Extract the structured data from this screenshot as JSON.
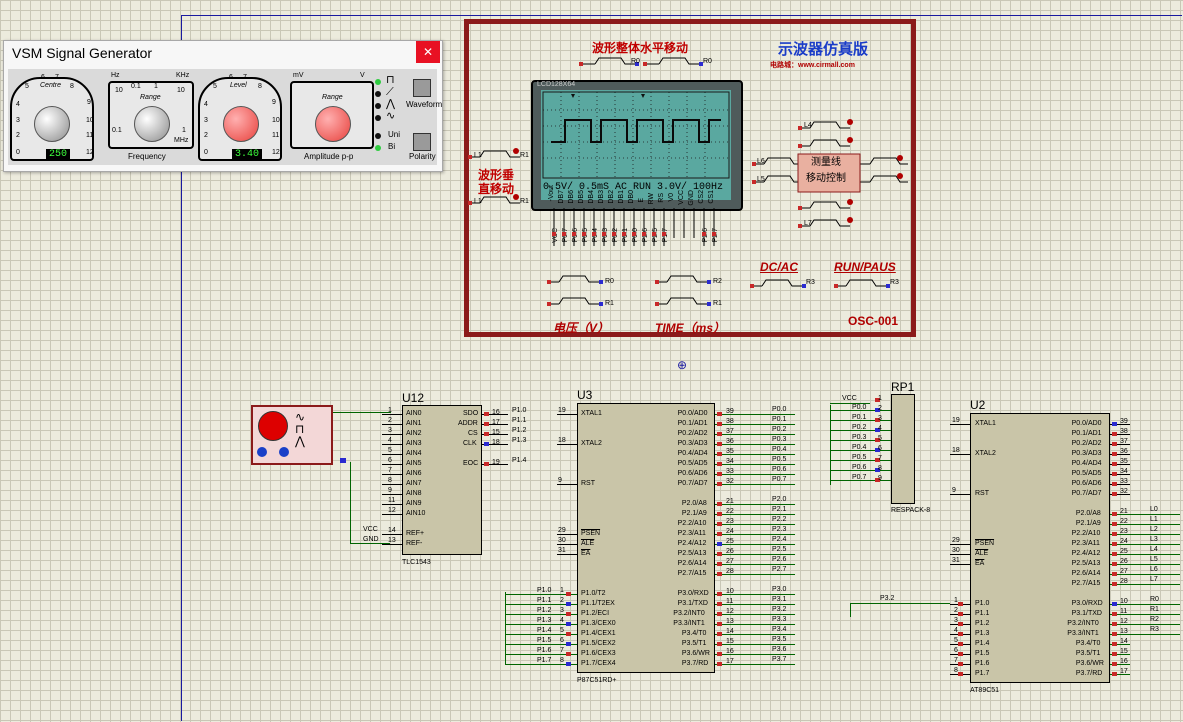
{
  "siggen": {
    "title": "VSM Signal Generator",
    "close_icon": "close-icon",
    "centre_label": "Centre",
    "range_label": "Range",
    "level_label": "Level",
    "amp_range_label": "Range",
    "frequency_label": "Frequency",
    "amplitude_label": "Amplitude p-p",
    "waveform_label": "Waveform",
    "polarity_label": "Polarity",
    "uni_label": "Uni",
    "bi_label": "Bi",
    "centre_value": "250",
    "level_value": "3.40",
    "hz_label": "Hz",
    "khz_label": "KHz",
    "mhz_label": "MHz",
    "mv_label": "mV",
    "v_label": "V",
    "scale_a": [
      "5",
      "6",
      "7",
      "8",
      "9",
      "10",
      "11",
      "12",
      "4",
      "3",
      "2",
      "1",
      "0"
    ],
    "range_a": [
      "10",
      "0.1",
      "1",
      "10",
      "0.1",
      "1"
    ],
    "scale_c": [
      "5",
      "6",
      "7",
      "8",
      "9",
      "10",
      "11",
      "12",
      "4",
      "3",
      "2",
      "1",
      "0"
    ],
    "range_c": [
      "mV",
      "V"
    ]
  },
  "osc": {
    "title": "示波器仿真版",
    "vendor": "电路城：www.cirmall.com",
    "h_move": "波形整体水平移动",
    "v_move": "波形垂直移动",
    "v_move_1": "波形垂",
    "v_move_2": "直移动",
    "measure_1": "测量线",
    "measure_2": "移动控制",
    "lcd_model": "LCD128X64",
    "status": "0.5V/  0.5mS AC RUN 3.0V/  100Hz",
    "dcac": "DC/AC",
    "runpaus": "RUN/PAUS",
    "voltage": "电压（V）",
    "time": "TIME（ms）",
    "name": "OSC-001",
    "lcd_pins": [
      "-Vout",
      "DB7",
      "DB6",
      "DB5",
      "DB4",
      "DB3",
      "DB2",
      "DB1",
      "DB0",
      "E",
      "RW",
      "RS",
      "V0",
      "VCC",
      "GND",
      "CS2",
      "CS1"
    ],
    "lcd_wires": [
      "VCC",
      "P0.7",
      "P0.6",
      "P0.5",
      "P0.4",
      "P0.3",
      "P0.2",
      "P0.1",
      "P0.0",
      "P2.6",
      "P2.5",
      "P1.7",
      "",
      "",
      "",
      "P2.6",
      "P2.7"
    ],
    "btn_labels": {
      "r0a": "R0",
      "r0b": "R0",
      "l1": "L1",
      "l1b": "L1",
      "r1": "R1",
      "r1b": "R1",
      "r0c": "R0",
      "r1c": "R1",
      "r2": "R2",
      "r1d": "R1",
      "l6": "L6",
      "l5": "L5",
      "l4": "L4",
      "l7": "L7",
      "r3": "R3",
      "r3b": "R3"
    }
  },
  "chips": {
    "u12": {
      "name": "U12",
      "part": "TLC1543",
      "left": [
        "AIN0",
        "AIN1",
        "AIN2",
        "AIN3",
        "AIN4",
        "AIN5",
        "AIN6",
        "AIN7",
        "AIN8",
        "AIN9",
        "AIN10",
        "REF+",
        "REF-"
      ],
      "left_nums": [
        "1",
        "2",
        "3",
        "4",
        "5",
        "6",
        "7",
        "8",
        "9",
        "11",
        "12",
        "14",
        "13"
      ],
      "right": [
        "SDO",
        "ADDR",
        "CS",
        "CLK",
        "EOC"
      ],
      "right_nums": [
        "16",
        "17",
        "15",
        "18",
        "19"
      ],
      "right_nets": [
        "P1.0",
        "P1.1",
        "P1.2",
        "P1.3",
        "P1.4"
      ],
      "vcc": "VCC",
      "gnd": "GND"
    },
    "u3": {
      "name": "U3",
      "part": "P87C51RD+",
      "left_top": [
        "XTAL1",
        "XTAL2",
        "RST",
        "PSEN",
        "ALE",
        "EA"
      ],
      "left_top_nums": [
        "19",
        "18",
        "9",
        "29",
        "30",
        "31"
      ],
      "left_p1": [
        "P1.0/T2",
        "P1.1/T2EX",
        "P1.2/ECI",
        "P1.3/CEX0",
        "P1.4/CEX1",
        "P1.5/CEX2",
        "P1.6/CEX3",
        "P1.7/CEX4"
      ],
      "left_p1_nums": [
        "1",
        "2",
        "3",
        "4",
        "5",
        "6",
        "7",
        "8"
      ],
      "left_p1_nets": [
        "P1.0",
        "P1.1",
        "P1.2",
        "P1.3",
        "P1.4",
        "P1.5",
        "P1.6",
        "P1.7"
      ],
      "right_p0": [
        "P0.0/AD0",
        "P0.1/AD1",
        "P0.2/AD2",
        "P0.3/AD3",
        "P0.4/AD4",
        "P0.5/AD5",
        "P0.6/AD6",
        "P0.7/AD7"
      ],
      "right_p0_nums": [
        "39",
        "38",
        "37",
        "36",
        "35",
        "34",
        "33",
        "32"
      ],
      "right_p0_nets": [
        "P0.0",
        "P0.1",
        "P0.2",
        "P0.3",
        "P0.4",
        "P0.5",
        "P0.6",
        "P0.7"
      ],
      "right_p2": [
        "P2.0/A8",
        "P2.1/A9",
        "P2.2/A10",
        "P2.3/A11",
        "P2.4/A12",
        "P2.5/A13",
        "P2.6/A14",
        "P2.7/A15"
      ],
      "right_p2_nums": [
        "21",
        "22",
        "23",
        "24",
        "25",
        "26",
        "27",
        "28"
      ],
      "right_p2_nets": [
        "P2.0",
        "P2.1",
        "P2.2",
        "P2.3",
        "P2.4",
        "P2.5",
        "P2.6",
        "P2.7"
      ],
      "right_p3": [
        "P3.0/RXD",
        "P3.1/TXD",
        "P3.2/INT0",
        "P3.3/INT1",
        "P3.4/T0",
        "P3.5/T1",
        "P3.6/WR",
        "P3.7/RD"
      ],
      "right_p3_nums": [
        "10",
        "11",
        "12",
        "13",
        "14",
        "15",
        "16",
        "17"
      ],
      "right_p3_nets": [
        "P3.0",
        "P3.1",
        "P3.2",
        "P3.3",
        "P3.4",
        "P3.5",
        "P3.6",
        "P3.7"
      ]
    },
    "rp1": {
      "name": "RP1",
      "part": "RESPACK-8",
      "vcc": "VCC",
      "nets": [
        "P0.0",
        "P0.1",
        "P0.2",
        "P0.3",
        "P0.4",
        "P0.5",
        "P0.6",
        "P0.7"
      ],
      "nums": [
        "1",
        "2",
        "3",
        "4",
        "5",
        "6",
        "7",
        "8",
        "9"
      ]
    },
    "u2": {
      "name": "U2",
      "part": "AT89C51",
      "left_top": [
        "XTAL1",
        "XTAL2",
        "RST",
        "PSEN",
        "ALE",
        "EA"
      ],
      "left_top_nums": [
        "19",
        "18",
        "9",
        "29",
        "30",
        "31"
      ],
      "left_p1": [
        "P1.0",
        "P1.1",
        "P1.2",
        "P1.3",
        "P1.4",
        "P1.5",
        "P1.6",
        "P1.7"
      ],
      "left_p1_nums": [
        "1",
        "2",
        "3",
        "4",
        "5",
        "6",
        "7",
        "8"
      ],
      "p32": "P3.2",
      "right_p0": [
        "P0.0/AD0",
        "P0.1/AD1",
        "P0.2/AD2",
        "P0.3/AD3",
        "P0.4/AD4",
        "P0.5/AD5",
        "P0.6/AD6",
        "P0.7/AD7"
      ],
      "right_p0_nums": [
        "39",
        "38",
        "37",
        "36",
        "35",
        "34",
        "33",
        "32"
      ],
      "right_p2": [
        "P2.0/A8",
        "P2.1/A9",
        "P2.2/A10",
        "P2.3/A11",
        "P2.4/A12",
        "P2.5/A13",
        "P2.6/A14",
        "P2.7/A15"
      ],
      "right_p2_nums": [
        "21",
        "22",
        "23",
        "24",
        "25",
        "26",
        "27",
        "28"
      ],
      "right_p2_nets": [
        "L0",
        "L1",
        "L2",
        "L3",
        "L4",
        "L5",
        "L6",
        "L7"
      ],
      "right_p3": [
        "P3.0/RXD",
        "P3.1/TXD",
        "P3.2/INT0",
        "P3.3/INT1",
        "P3.4/T0",
        "P3.5/T1",
        "P3.6/WR",
        "P3.7/RD"
      ],
      "right_p3_nums": [
        "10",
        "11",
        "12",
        "13",
        "14",
        "15",
        "16",
        "17"
      ],
      "right_p3_nets": [
        "R0",
        "R1",
        "R2",
        "R3",
        "",
        "",
        "",
        ""
      ]
    }
  }
}
